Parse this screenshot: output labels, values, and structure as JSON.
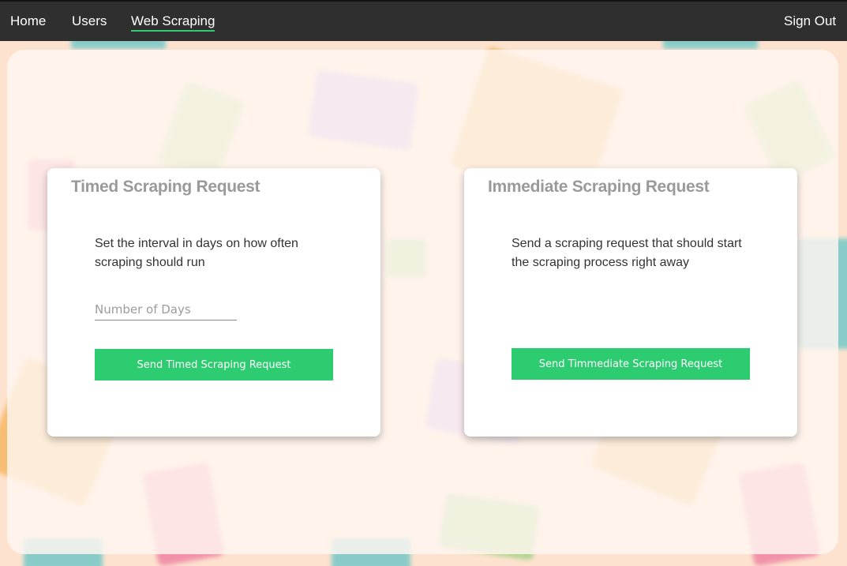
{
  "nav": {
    "home": "Home",
    "users": "Users",
    "web_scraping": "Web Scraping",
    "sign_out": "Sign Out",
    "active_color": "#2ecc71"
  },
  "timed": {
    "title": "Timed Scraping Request",
    "description": "Set the interval in days on how often scraping should run",
    "input_placeholder": "Number of Days",
    "input_value": "",
    "button_label": "Send Timed Scraping Request"
  },
  "immediate": {
    "title": "Immediate Scraping Request",
    "description": "Send a scraping request that should start the scraping process right away",
    "button_label": "Send Timmediate Scraping Request"
  },
  "colors": {
    "navbar": "#2f2f2f",
    "button": "#2ecc71",
    "title": "#9a9a9a",
    "page_background": "#fde3cf"
  }
}
